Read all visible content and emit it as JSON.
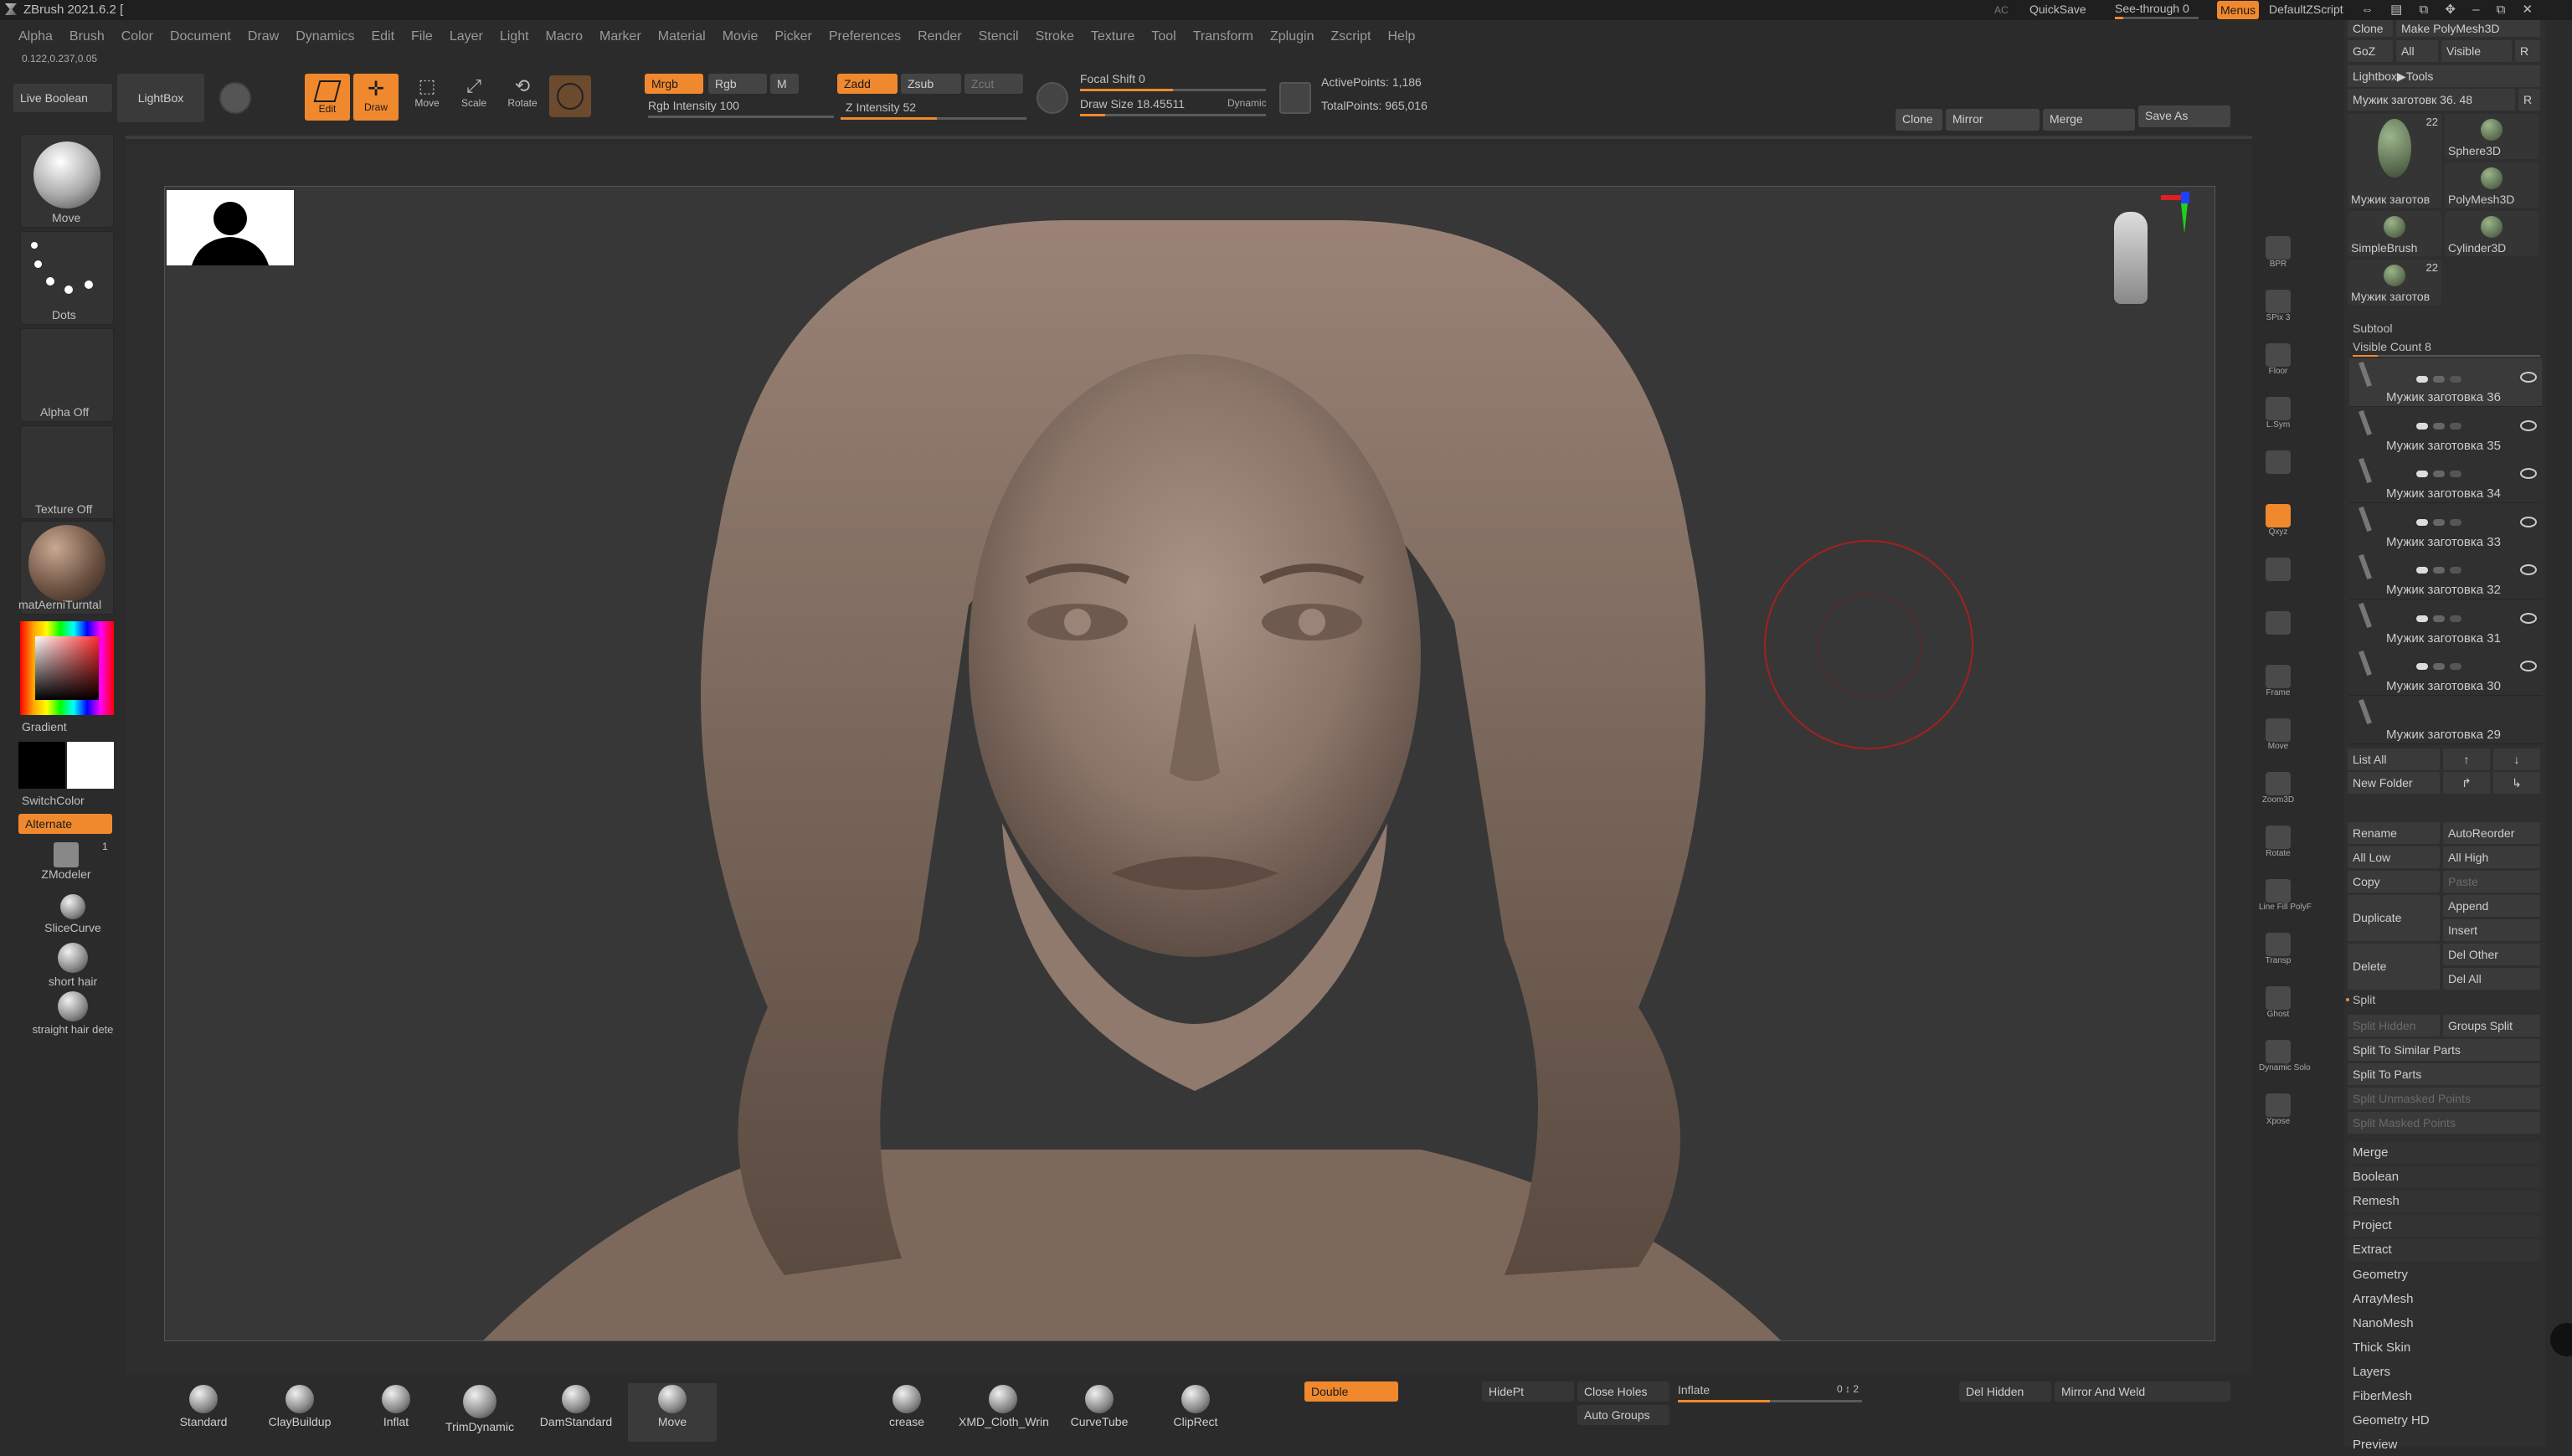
{
  "titlebar": {
    "app_title": "ZBrush 2021.6.2 [",
    "ac_label": "AC",
    "quicksave": "QuickSave",
    "seethrough": "See-through  0",
    "menus": "Menus",
    "script": "DefaultZScript"
  },
  "menu": [
    "Alpha",
    "Brush",
    "Color",
    "Document",
    "Draw",
    "Dynamics",
    "Edit",
    "File",
    "Layer",
    "Light",
    "Macro",
    "Marker",
    "Material",
    "Movie",
    "Picker",
    "Preferences",
    "Render",
    "Stencil",
    "Stroke",
    "Texture",
    "Tool",
    "Transform",
    "Zplugin",
    "Zscript",
    "Help"
  ],
  "coords": "0.122,0.237,0.05",
  "top": {
    "live_boolean": "Live Boolean",
    "lightbox": "LightBox",
    "edit": "Edit",
    "draw": "Draw",
    "move": "Move",
    "scale": "Scale",
    "rotate": "Rotate",
    "mrgb": "Mrgb",
    "rgb": "Rgb",
    "m": "M",
    "rgb_intensity": "Rgb Intensity 100",
    "zadd": "Zadd",
    "zsub": "Zsub",
    "zcut": "Zcut",
    "z_intensity": "Z Intensity 52",
    "focal_shift": "Focal Shift 0",
    "draw_size": "Draw Size 18.45511",
    "dynamic": "Dynamic",
    "active_points": "ActivePoints: 1,186",
    "total_points": "TotalPoints: 965,016",
    "clone": "Clone",
    "mirror": "Mirror",
    "merge": "Merge",
    "save_as": "Save As"
  },
  "left": {
    "move": "Move",
    "dots": "Dots",
    "alpha_off": "Alpha Off",
    "texture_off": "Texture Off",
    "material": "matAerniTurntal",
    "gradient": "Gradient",
    "switchcolor": "SwitchColor",
    "alternate": "Alternate",
    "zmodeler": "ZModeler",
    "zmodeler_count": "1",
    "slicecurve": "SliceCurve",
    "short_hair": "short hair",
    "straight_hair": "straight hair dete"
  },
  "right_strip": [
    "BPR",
    "SPix 3",
    "Floor",
    "L.Sym",
    "",
    "Qxyz",
    "",
    "",
    "Frame",
    "Move",
    "Zoom3D",
    "Rotate",
    "Line Fill PolyF",
    "Transp",
    "Ghost",
    "Dynamic Solo",
    "Xpose"
  ],
  "right_panel": {
    "top_clone": "Clone",
    "top_make": "Make PolyMesh3D",
    "goz": "GoZ",
    "all": "All",
    "visible": "Visible",
    "r": "R",
    "lightbox_tools": "Lightbox▶Tools",
    "current_tool": "Мужик заготовк 36. 48",
    "current_tool_r": "R",
    "tools": [
      {
        "label": "Мужик заготов",
        "count": "22"
      },
      {
        "label": "Sphere3D",
        "count": ""
      },
      {
        "label": "PolyMesh3D",
        "count": ""
      },
      {
        "label": "SimpleBrush",
        "count": ""
      },
      {
        "label": "Cylinder3D",
        "count": ""
      },
      {
        "label": "Мужик заготов",
        "count": "22"
      }
    ],
    "subtool": "Subtool",
    "visible_count": "Visible Count 8",
    "subtools": [
      "Мужик заготовка 36",
      "Мужик заготовка 35",
      "Мужик заготовка 34",
      "Мужик заготовка 33",
      "Мужик заготовка 32",
      "Мужик заготовка 31",
      "Мужик заготовка 30",
      "Мужик заготовка 29"
    ],
    "list_all": "List All",
    "new_folder": "New Folder",
    "rename": "Rename",
    "autoreorder": "AutoReorder",
    "all_low": "All Low",
    "all_high": "All High",
    "copy": "Copy",
    "paste": "Paste",
    "duplicate": "Duplicate",
    "append": "Append",
    "insert": "Insert",
    "delete": "Delete",
    "del_other": "Del Other",
    "del_all": "Del All",
    "split": "Split",
    "split_hidden": "Split Hidden",
    "groups_split": "Groups Split",
    "split_similar": "Split To Similar Parts",
    "split_parts": "Split To Parts",
    "split_unmasked": "Split Unmasked Points",
    "split_masked": "Split Masked Points",
    "sections": [
      "Merge",
      "Boolean",
      "Remesh",
      "Project",
      "Extract"
    ],
    "lower_sections": [
      "Geometry",
      "ArrayMesh",
      "NanoMesh",
      "Thick Skin",
      "Layers",
      "FiberMesh",
      "Geometry HD",
      "Preview"
    ]
  },
  "bottom": {
    "brushes": [
      "Standard",
      "ClayBuildup",
      "Inflat",
      "TrimDynamic",
      "DamStandard",
      "Move",
      "crease",
      "XMD_Cloth_Wrin",
      "CurveTube",
      "ClipRect"
    ],
    "double": "Double",
    "hidept": "HidePt",
    "close_holes": "Close Holes",
    "auto_groups": "Auto Groups",
    "inflate": "Inflate",
    "inflate_val": "0 ↕ 2",
    "del_hidden": "Del Hidden",
    "mirror_weld": "Mirror And Weld"
  },
  "colors": {
    "accent": "#f0892e",
    "viewport_bg": "#373737"
  }
}
